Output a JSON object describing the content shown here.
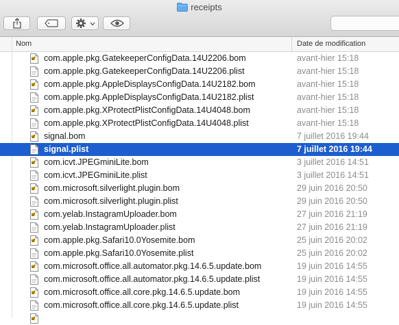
{
  "window": {
    "title": "receipts"
  },
  "toolbar": {
    "share_icon": "share-icon",
    "tag_icon": "tag-icon",
    "action_icon": "gear-icon",
    "quicklook_icon": "eye-icon"
  },
  "columns": {
    "name": "Nom",
    "date": "Date de modification"
  },
  "rows": [
    {
      "name": "com.apple.pkg.GatekeeperConfigData.14U2206.bom",
      "date": "avant-hier 15:18",
      "kind": "bom",
      "selected": false
    },
    {
      "name": "com.apple.pkg.GatekeeperConfigData.14U2206.plist",
      "date": "avant-hier 15:18",
      "kind": "plist",
      "selected": false
    },
    {
      "name": "com.apple.pkg.AppleDisplaysConfigData.14U2182.bom",
      "date": "avant-hier 15:18",
      "kind": "bom",
      "selected": false
    },
    {
      "name": "com.apple.pkg.AppleDisplaysConfigData.14U2182.plist",
      "date": "avant-hier 15:18",
      "kind": "plist",
      "selected": false
    },
    {
      "name": "com.apple.pkg.XProtectPlistConfigData.14U4048.bom",
      "date": "avant-hier 15:18",
      "kind": "bom",
      "selected": false
    },
    {
      "name": "com.apple.pkg.XProtectPlistConfigData.14U4048.plist",
      "date": "avant-hier 15:18",
      "kind": "plist",
      "selected": false
    },
    {
      "name": "signal.bom",
      "date": "7 juillet 2016 19:44",
      "kind": "bom",
      "selected": false
    },
    {
      "name": "signal.plist",
      "date": "7 juillet 2016 19:44",
      "kind": "plist",
      "selected": true
    },
    {
      "name": "com.icvt.JPEGminiLite.bom",
      "date": "3 juillet 2016 14:51",
      "kind": "bom",
      "selected": false
    },
    {
      "name": "com.icvt.JPEGminiLite.plist",
      "date": "3 juillet 2016 14:51",
      "kind": "plist",
      "selected": false
    },
    {
      "name": "com.microsoft.silverlight.plugin.bom",
      "date": "29 juin 2016 20:50",
      "kind": "bom",
      "selected": false
    },
    {
      "name": "com.microsoft.silverlight.plugin.plist",
      "date": "29 juin 2016 20:50",
      "kind": "plist",
      "selected": false
    },
    {
      "name": "com.yelab.InstagramUploader.bom",
      "date": "27 juin 2016 21:19",
      "kind": "bom",
      "selected": false
    },
    {
      "name": "com.yelab.InstagramUploader.plist",
      "date": "27 juin 2016 21:19",
      "kind": "plist",
      "selected": false
    },
    {
      "name": "com.apple.pkg.Safari10.0Yosemite.bom",
      "date": "25 juin 2016 20:02",
      "kind": "bom",
      "selected": false
    },
    {
      "name": "com.apple.pkg.Safari10.0Yosemite.plist",
      "date": "25 juin 2016 20:02",
      "kind": "plist",
      "selected": false
    },
    {
      "name": "com.microsoft.office.all.automator.pkg.14.6.5.update.bom",
      "date": "19 juin 2016 14:55",
      "kind": "bom",
      "selected": false
    },
    {
      "name": "com.microsoft.office.all.automator.pkg.14.6.5.update.plist",
      "date": "19 juin 2016 14:55",
      "kind": "plist",
      "selected": false
    },
    {
      "name": "com.microsoft.office.all.core.pkg.14.6.5.update.bom",
      "date": "19 juin 2016 14:55",
      "kind": "bom",
      "selected": false
    },
    {
      "name": "com.microsoft.office.all.core.pkg.14.6.5.update.plist",
      "date": "19 juin 2016 14:55",
      "kind": "plist",
      "selected": false
    },
    {
      "name": "",
      "date": "",
      "kind": "bom",
      "selected": false
    }
  ],
  "colors": {
    "selection": "#1d5ecf",
    "date_text": "#8c8c8c",
    "folder": "#62aef0"
  }
}
